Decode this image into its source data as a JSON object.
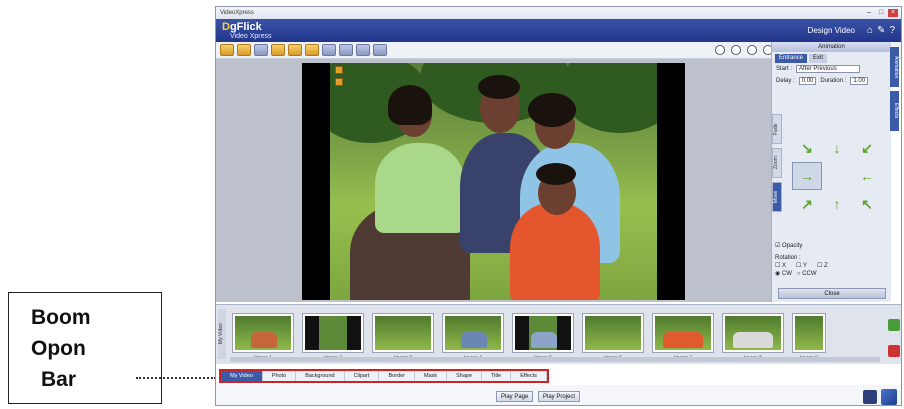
{
  "callout": {
    "lines": [
      "Boom",
      "Opon",
      "Bar"
    ]
  },
  "window": {
    "title": "VideoXpress",
    "minimize": "–",
    "maximize": "□",
    "close": "×"
  },
  "brand": {
    "logo_d": "D",
    "logo_rest": "gFlick",
    "logo_sub": "Video Xpress",
    "mode_label": "Design Video",
    "home_icon": "⌂",
    "settings_icon": "✎",
    "help_icon": "?"
  },
  "right_panel": {
    "title": "Animation",
    "tabs": [
      "Entrance",
      "Exit"
    ],
    "start_label": "Start :",
    "start_value": "After Previous",
    "delay_label": "Delay :",
    "delay_value": "0.00",
    "duration_label": "Duration :",
    "duration_value": "1.00",
    "vtabs": [
      "Fade",
      "Zoom",
      "Move"
    ],
    "arrows": [
      "↘",
      "↓",
      "↙",
      "→",
      "",
      "←",
      "↗",
      "↑",
      "↖"
    ],
    "opacity_label": "Opacity",
    "rotation_label": "Rotation :",
    "rotation_axes": [
      "X",
      "Y",
      "Z"
    ],
    "rotation_dirs": [
      "CW",
      "CCW"
    ],
    "close_label": "Close",
    "side_tabs": [
      "Animation",
      "Effects"
    ]
  },
  "filmstrip": {
    "left_label": "My Video",
    "thumbs": [
      {
        "label": "Image 1"
      },
      {
        "label": "Image 2"
      },
      {
        "label": "Image 3"
      },
      {
        "label": "Image 4"
      },
      {
        "label": "Image 5"
      },
      {
        "label": "Image 6"
      },
      {
        "label": "Image 7"
      },
      {
        "label": "Image 8"
      },
      {
        "label": "Image 9"
      }
    ]
  },
  "tabs": [
    "My Video",
    "Photo",
    "Background",
    "Clipart",
    "Border",
    "Mask",
    "Shape",
    "Title",
    "Effects"
  ],
  "bottom": {
    "play_page": "Play Page",
    "play_project": "Play Project"
  }
}
